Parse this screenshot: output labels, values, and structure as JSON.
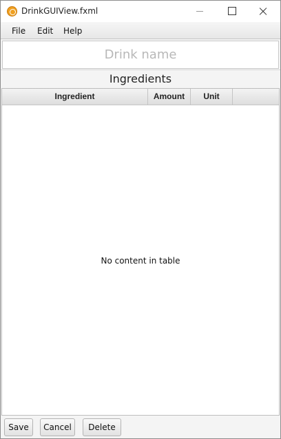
{
  "window": {
    "title": "DrinkGUIView.fxml"
  },
  "menu": {
    "items": [
      {
        "label": "File"
      },
      {
        "label": "Edit"
      },
      {
        "label": "Help"
      }
    ]
  },
  "drink_name": {
    "placeholder": "Drink name",
    "value": ""
  },
  "ingredients": {
    "section_label": "Ingredients",
    "columns": [
      "Ingredient",
      "Amount",
      "Unit"
    ],
    "rows": [],
    "empty_message": "No content in table"
  },
  "buttons": {
    "save": "Save",
    "cancel": "Cancel",
    "delete": "Delete"
  },
  "colors": {
    "app_icon": "#f0a020",
    "placeholder_text": "#b8b8b8"
  },
  "icons": {
    "app": "app-icon",
    "minimize": "minimize-icon",
    "maximize": "maximize-icon",
    "close": "close-icon"
  }
}
